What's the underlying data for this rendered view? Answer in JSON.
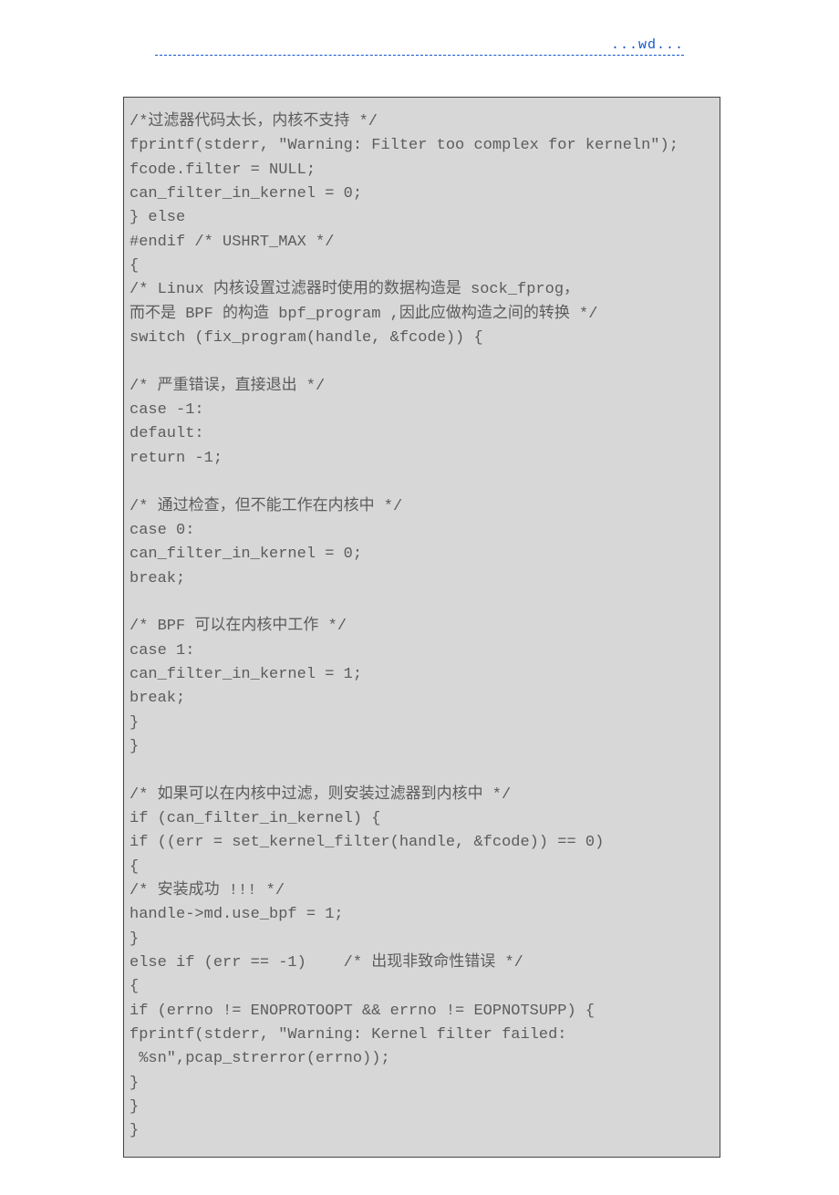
{
  "header": {
    "link_text": "...wd..."
  },
  "code": {
    "lines": [
      "/*过滤器代码太长，内核不支持 */",
      "fprintf(stderr, \"Warning: Filter too complex for kerneln\");",
      "fcode.filter = NULL;",
      "can_filter_in_kernel = 0;",
      "} else",
      "#endif /* USHRT_MAX */",
      "{",
      "/* Linux 内核设置过滤器时使用的数据构造是 sock_fprog，",
      "而不是 BPF 的构造 bpf_program ,因此应做构造之间的转换 */",
      "switch (fix_program(handle, &fcode)) {",
      "",
      "/* 严重错误，直接退出 */",
      "case -1:",
      "default:",
      "return -1;",
      "",
      "/* 通过检查，但不能工作在内核中 */",
      "case 0:",
      "can_filter_in_kernel = 0;",
      "break;",
      "",
      "/* BPF 可以在内核中工作 */",
      "case 1:",
      "can_filter_in_kernel = 1;",
      "break;",
      "}",
      "}",
      "",
      "/* 如果可以在内核中过滤，则安装过滤器到内核中 */",
      "if (can_filter_in_kernel) {",
      "if ((err = set_kernel_filter(handle, &fcode)) == 0)",
      "{",
      "/* 安装成功 !!! */",
      "handle->md.use_bpf = 1;",
      "}",
      "else if (err == -1)    /* 出现非致命性错误 */",
      "{",
      "if (errno != ENOPROTOOPT && errno != EOPNOTSUPP) {",
      "fprintf(stderr, \"Warning: Kernel filter failed:",
      " %sn\",pcap_strerror(errno));",
      "}",
      "}",
      "}"
    ]
  }
}
